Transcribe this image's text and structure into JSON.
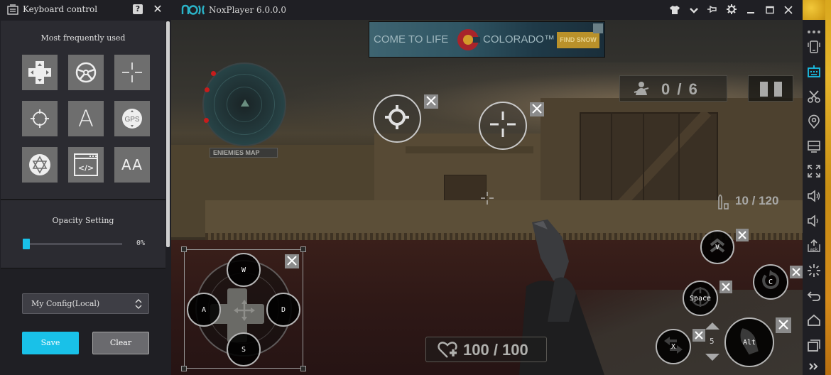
{
  "keyboard_panel": {
    "title": "Keyboard control",
    "help_label": "?",
    "close_label": "✕",
    "frequent_section_title": "Most frequently used",
    "tools": [
      {
        "name": "d-pad",
        "icon": "dpad-icon"
      },
      {
        "name": "steering-wheel",
        "icon": "steering-wheel-icon"
      },
      {
        "name": "crosshair",
        "icon": "crosshair-icon"
      },
      {
        "name": "fire",
        "icon": "target-icon"
      },
      {
        "name": "single-key",
        "label": "A",
        "icon": "letter-a-icon"
      },
      {
        "name": "gps",
        "label": "GPS",
        "icon": "gps-icon"
      },
      {
        "name": "star-of-david",
        "icon": "hexagram-icon"
      },
      {
        "name": "script",
        "label": "</>",
        "icon": "script-icon"
      },
      {
        "name": "multi-key",
        "label": "AA",
        "icon": "double-a-icon"
      }
    ],
    "opacity": {
      "title": "Opacity Setting",
      "value_percent": 0,
      "value_label": "0%"
    },
    "config_select": {
      "value": "My Config(Local)"
    },
    "save_label": "Save",
    "clear_label": "Clear"
  },
  "titlebar": {
    "logo_text": "nox",
    "app_title": "NoxPlayer 6.0.0.0",
    "buttons": [
      "skin-icon",
      "dropdown-icon",
      "pin-icon",
      "settings-icon",
      "minimize-icon",
      "maximize-icon",
      "close-icon"
    ]
  },
  "sidebar": {
    "items": [
      "more-icon",
      "shake-icon",
      "keyboard-icon",
      "screenshot-icon",
      "location-icon",
      "multi-instance-icon",
      "fullscreen-icon",
      "volume-up-icon",
      "volume-down-icon",
      "apk-install-icon",
      "loading-icon",
      "back-icon",
      "home-icon",
      "recent-apps-icon",
      "expand-icon"
    ]
  },
  "game": {
    "ad": {
      "text_left": "COME TO LIFE",
      "text_right": "COLORADO™",
      "cta": "FIND SNOW"
    },
    "radar_label": "ENIEMIES MAP",
    "score": "0 / 6",
    "ammo": "10 / 120",
    "health": "100 / 100",
    "keys": {
      "w": "W",
      "a": "A",
      "s": "S",
      "d": "D",
      "v": "V",
      "c": "C",
      "space": "Space",
      "x": "X",
      "alt": "Alt"
    },
    "stepper_value": "5",
    "colors": {
      "accent": "#19c1e8",
      "panel_bg": "#2b2b31",
      "titlebar_bg": "#1f1f24"
    }
  }
}
